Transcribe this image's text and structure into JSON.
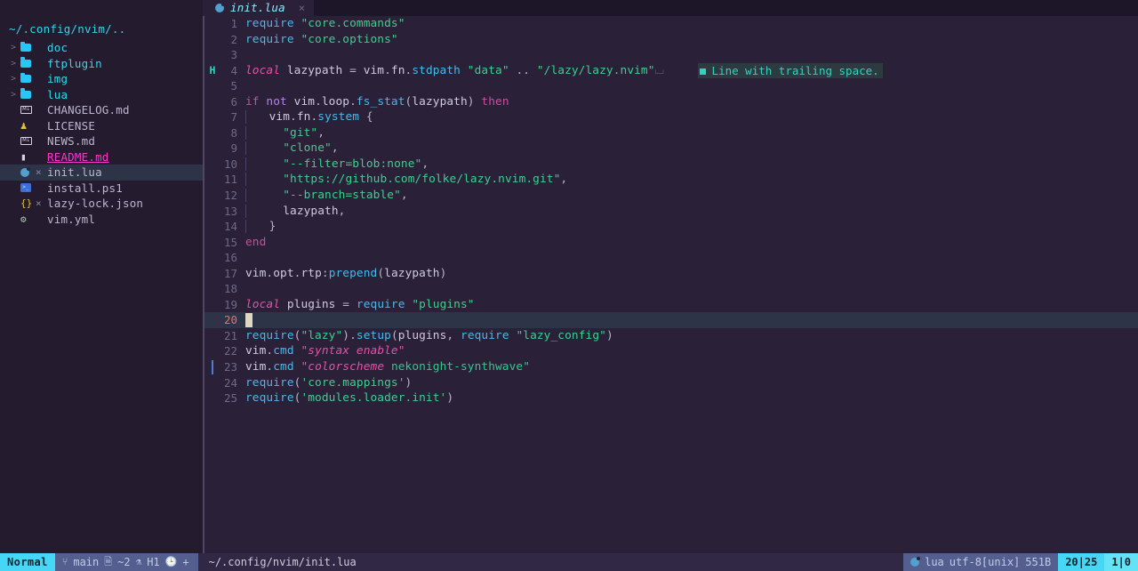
{
  "tabline": {
    "tabs": [
      {
        "icon": "lua-file-icon",
        "label": "init.lua",
        "close": "×"
      }
    ]
  },
  "sidebar": {
    "root_label": "~/.config/nvim/..",
    "items": [
      {
        "chevron": ">",
        "icon": "folder-icon",
        "label": "doc",
        "git": "",
        "kind": "dir",
        "selected": false
      },
      {
        "chevron": ">",
        "icon": "folder-icon",
        "label": "ftplugin",
        "git": "",
        "kind": "dir",
        "selected": false
      },
      {
        "chevron": ">",
        "icon": "folder-icon",
        "label": "img",
        "git": "",
        "kind": "dir",
        "selected": false
      },
      {
        "chevron": ">",
        "icon": "folder-icon",
        "label": "lua",
        "git": "",
        "kind": "dir",
        "selected": false
      },
      {
        "chevron": "",
        "icon": "markdown-icon",
        "label": "CHANGELOG.md",
        "git": "",
        "kind": "file",
        "selected": false
      },
      {
        "chevron": "",
        "icon": "license-icon",
        "label": "LICENSE",
        "git": "",
        "kind": "file",
        "selected": false
      },
      {
        "chevron": "",
        "icon": "markdown-icon",
        "label": "NEWS.md",
        "git": "",
        "kind": "file",
        "selected": false
      },
      {
        "chevron": "",
        "icon": "readme-book-icon",
        "label": "README.md",
        "git": "",
        "kind": "cursor",
        "selected": false
      },
      {
        "chevron": "",
        "icon": "lua-file-icon",
        "label": "init.lua",
        "git": "×",
        "kind": "file",
        "selected": true
      },
      {
        "chevron": "",
        "icon": "powershell-icon",
        "label": "install.ps1",
        "git": "",
        "kind": "file",
        "selected": false
      },
      {
        "chevron": "",
        "icon": "json-braces-icon",
        "label": "lazy-lock.json",
        "git": "×",
        "kind": "file",
        "selected": false
      },
      {
        "chevron": "",
        "icon": "gear-icon",
        "label": "vim.yml",
        "git": "",
        "kind": "file",
        "selected": false
      }
    ]
  },
  "editor": {
    "lines": [
      {
        "n": "1",
        "sign": "",
        "tokens": [
          {
            "t": "require",
            "c": "fn"
          },
          {
            "t": " ",
            "c": "ident"
          },
          {
            "t": "\"core.commands\"",
            "c": "str"
          }
        ]
      },
      {
        "n": "2",
        "sign": "",
        "tokens": [
          {
            "t": "require",
            "c": "fn"
          },
          {
            "t": " ",
            "c": "ident"
          },
          {
            "t": "\"core.options\"",
            "c": "str"
          }
        ]
      },
      {
        "n": "3",
        "sign": "",
        "tokens": []
      },
      {
        "n": "4",
        "sign": "H",
        "tokens": [
          {
            "t": "local",
            "c": "local"
          },
          {
            "t": " lazypath ",
            "c": "ident"
          },
          {
            "t": "=",
            "c": "punc"
          },
          {
            "t": " vim",
            "c": "ident"
          },
          {
            "t": ".",
            "c": "punc"
          },
          {
            "t": "fn",
            "c": "ident"
          },
          {
            "t": ".",
            "c": "punc"
          },
          {
            "t": "stdpath",
            "c": "fn"
          },
          {
            "t": " ",
            "c": "ident"
          },
          {
            "t": "\"data\"",
            "c": "str"
          },
          {
            "t": " ",
            "c": "ident"
          },
          {
            "t": "..",
            "c": "punc"
          },
          {
            "t": " ",
            "c": "ident"
          },
          {
            "t": "\"/lazy/lazy.nvim\"",
            "c": "str"
          }
        ],
        "trailing_space": true,
        "diagnostic": "Line with trailing space."
      },
      {
        "n": "5",
        "sign": "",
        "tokens": []
      },
      {
        "n": "6",
        "sign": "",
        "tokens": [
          {
            "t": "if",
            "c": "kw"
          },
          {
            "t": " ",
            "c": "ident"
          },
          {
            "t": "not",
            "c": "kw2"
          },
          {
            "t": " vim",
            "c": "ident"
          },
          {
            "t": ".",
            "c": "punc"
          },
          {
            "t": "loop",
            "c": "ident"
          },
          {
            "t": ".",
            "c": "punc"
          },
          {
            "t": "fs_stat",
            "c": "fn"
          },
          {
            "t": "(",
            "c": "punc"
          },
          {
            "t": "lazypath",
            "c": "ident"
          },
          {
            "t": ")",
            "c": "punc"
          },
          {
            "t": " ",
            "c": "ident"
          },
          {
            "t": "then",
            "c": "kw"
          }
        ]
      },
      {
        "n": "7",
        "sign": "",
        "tokens": [
          {
            "t": "  vim",
            "c": "ident"
          },
          {
            "t": ".",
            "c": "punc"
          },
          {
            "t": "fn",
            "c": "ident"
          },
          {
            "t": ".",
            "c": "punc"
          },
          {
            "t": "system",
            "c": "fn"
          },
          {
            "t": " ",
            "c": "ident"
          },
          {
            "t": "{",
            "c": "punc"
          }
        ],
        "guides": 0
      },
      {
        "n": "8",
        "sign": "",
        "tokens": [
          {
            "t": "    ",
            "c": "ident"
          },
          {
            "t": "\"git\"",
            "c": "str"
          },
          {
            "t": ",",
            "c": "punc"
          }
        ],
        "guides": 1
      },
      {
        "n": "9",
        "sign": "",
        "tokens": [
          {
            "t": "    ",
            "c": "ident"
          },
          {
            "t": "\"clone\"",
            "c": "str"
          },
          {
            "t": ",",
            "c": "punc"
          }
        ],
        "guides": 1
      },
      {
        "n": "10",
        "sign": "",
        "tokens": [
          {
            "t": "    ",
            "c": "ident"
          },
          {
            "t": "\"--filter=blob:none\"",
            "c": "str"
          },
          {
            "t": ",",
            "c": "punc"
          }
        ],
        "guides": 1
      },
      {
        "n": "11",
        "sign": "",
        "tokens": [
          {
            "t": "    ",
            "c": "ident"
          },
          {
            "t": "\"https://github.com/folke/lazy.nvim.git\"",
            "c": "str"
          },
          {
            "t": ",",
            "c": "punc"
          }
        ],
        "guides": 1
      },
      {
        "n": "12",
        "sign": "",
        "tokens": [
          {
            "t": "    ",
            "c": "ident"
          },
          {
            "t": "\"--branch=stable\"",
            "c": "str"
          },
          {
            "t": ",",
            "c": "punc"
          }
        ],
        "guides": 1
      },
      {
        "n": "13",
        "sign": "",
        "tokens": [
          {
            "t": "    lazypath",
            "c": "ident"
          },
          {
            "t": ",",
            "c": "punc"
          }
        ],
        "guides": 1
      },
      {
        "n": "14",
        "sign": "",
        "tokens": [
          {
            "t": "  ",
            "c": "ident"
          },
          {
            "t": "}",
            "c": "punc"
          }
        ],
        "guides": 0
      },
      {
        "n": "15",
        "sign": "",
        "tokens": [
          {
            "t": "end",
            "c": "kw"
          }
        ]
      },
      {
        "n": "16",
        "sign": "",
        "tokens": []
      },
      {
        "n": "17",
        "sign": "",
        "tokens": [
          {
            "t": "vim",
            "c": "ident"
          },
          {
            "t": ".",
            "c": "punc"
          },
          {
            "t": "opt",
            "c": "ident"
          },
          {
            "t": ".",
            "c": "punc"
          },
          {
            "t": "rtp",
            "c": "ident"
          },
          {
            "t": ":",
            "c": "punc"
          },
          {
            "t": "prepend",
            "c": "fn"
          },
          {
            "t": "(",
            "c": "punc"
          },
          {
            "t": "lazypath",
            "c": "ident"
          },
          {
            "t": ")",
            "c": "punc"
          }
        ]
      },
      {
        "n": "18",
        "sign": "",
        "tokens": []
      },
      {
        "n": "19",
        "sign": "",
        "tokens": [
          {
            "t": "local",
            "c": "local"
          },
          {
            "t": " plugins ",
            "c": "ident"
          },
          {
            "t": "=",
            "c": "punc"
          },
          {
            "t": " ",
            "c": "ident"
          },
          {
            "t": "require",
            "c": "fn"
          },
          {
            "t": " ",
            "c": "ident"
          },
          {
            "t": "\"plugins\"",
            "c": "str"
          }
        ]
      },
      {
        "n": "20",
        "sign": "",
        "tokens": [],
        "cursorline": true,
        "cursor": true
      },
      {
        "n": "21",
        "sign": "",
        "tokens": [
          {
            "t": "require",
            "c": "fn"
          },
          {
            "t": "(",
            "c": "punc"
          },
          {
            "t": "\"lazy\"",
            "c": "str"
          },
          {
            "t": ")",
            "c": "punc"
          },
          {
            "t": ".",
            "c": "punc"
          },
          {
            "t": "setup",
            "c": "fn"
          },
          {
            "t": "(",
            "c": "punc"
          },
          {
            "t": "plugins",
            "c": "ident"
          },
          {
            "t": ",",
            "c": "punc"
          },
          {
            "t": " ",
            "c": "ident"
          },
          {
            "t": "require",
            "c": "fn"
          },
          {
            "t": " ",
            "c": "ident"
          },
          {
            "t": "\"lazy_config\"",
            "c": "str"
          },
          {
            "t": ")",
            "c": "punc"
          }
        ]
      },
      {
        "n": "22",
        "sign": "",
        "tokens": [
          {
            "t": "vim",
            "c": "ident"
          },
          {
            "t": ".",
            "c": "punc"
          },
          {
            "t": "cmd",
            "c": "fn"
          },
          {
            "t": " ",
            "c": "ident"
          },
          {
            "t": "\"syntax enable\"",
            "c": "vimstr-it"
          }
        ]
      },
      {
        "n": "23",
        "sign": "bar",
        "tokens": [
          {
            "t": "vim",
            "c": "ident"
          },
          {
            "t": ".",
            "c": "punc"
          },
          {
            "t": "cmd",
            "c": "fn"
          },
          {
            "t": " ",
            "c": "ident"
          },
          {
            "t": "\"colorscheme ",
            "c": "vimstr-it"
          },
          {
            "t": "nekonight-synthwave\"",
            "c": "str2"
          }
        ]
      },
      {
        "n": "24",
        "sign": "",
        "tokens": [
          {
            "t": "require",
            "c": "fn"
          },
          {
            "t": "(",
            "c": "punc"
          },
          {
            "t": "'core.mappings'",
            "c": "str"
          },
          {
            "t": ")",
            "c": "punc"
          }
        ]
      },
      {
        "n": "25",
        "sign": "",
        "tokens": [
          {
            "t": "require",
            "c": "fn"
          },
          {
            "t": "(",
            "c": "punc"
          },
          {
            "t": "'modules.loader.init'",
            "c": "str"
          },
          {
            "t": ")",
            "c": "punc"
          }
        ]
      }
    ]
  },
  "statusline": {
    "mode": "Normal",
    "git_branch_icon": "git-branch-icon",
    "git_branch": "main",
    "diff_icon": "file-changed-icon",
    "diff_count": "~2",
    "diagnostic_icon": "flask-icon",
    "diagnostic_count": "H1",
    "clock_icon": "clock-icon",
    "clock_value": "+",
    "file_path": "~/.config/nvim/init.lua",
    "filetype_icon": "lua-file-icon",
    "filetype": "lua",
    "encoding": "utf-8[unix]",
    "filesize": "551B",
    "position": "20|25",
    "progress": "1|0"
  }
}
